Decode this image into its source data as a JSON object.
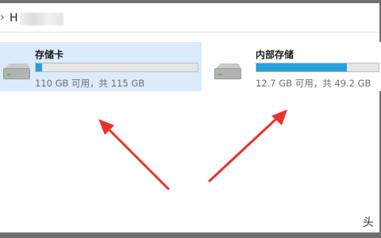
{
  "address": {
    "chevron": "›",
    "path_visible": "H                MH"
  },
  "drives": [
    {
      "name": "存储卡",
      "status": "110 GB 可用，共 115 GB",
      "used_fraction": 0.04,
      "selected": true,
      "icon": "hard-drive-icon"
    },
    {
      "name": "内部存储",
      "status": "12.7 GB 可用，共 49.2 GB",
      "used_fraction": 0.74,
      "selected": false,
      "icon": "hard-drive-icon"
    }
  ],
  "colors": {
    "selection": "#dcebfb",
    "bar_fill": "#26a0da",
    "annotation_arrow": "#e8332a"
  },
  "watermark": "头"
}
